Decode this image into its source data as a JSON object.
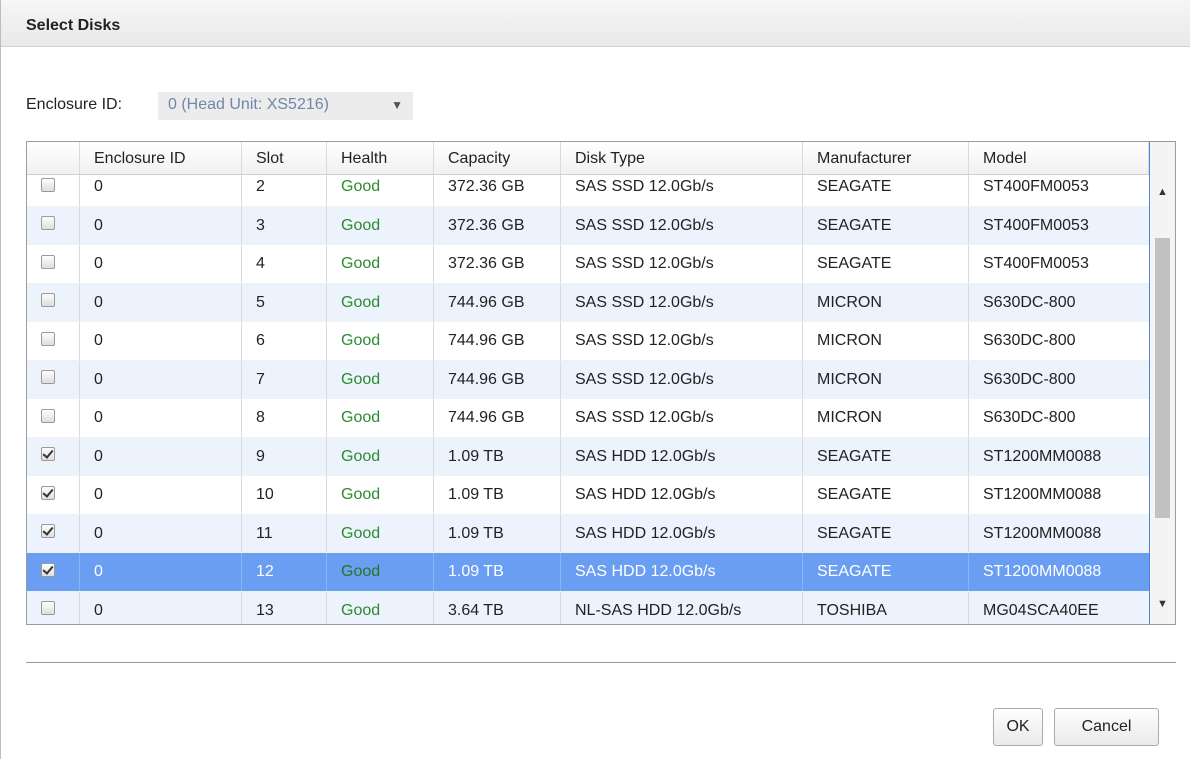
{
  "dialog": {
    "title": "Select Disks"
  },
  "enclosure": {
    "label": "Enclosure ID:",
    "selected": "0 (Head Unit: XS5216)"
  },
  "table": {
    "columns": [
      "",
      "Enclosure ID",
      "Slot",
      "Health",
      "Capacity",
      "Disk Type",
      "Manufacturer",
      "Model"
    ],
    "rows": [
      {
        "checked": false,
        "selected": false,
        "enclosure_id": "0",
        "slot": "2",
        "health": "Good",
        "capacity": "372.36 GB",
        "disk_type": "SAS SSD 12.0Gb/s",
        "manufacturer": "SEAGATE",
        "model": "ST400FM0053"
      },
      {
        "checked": false,
        "selected": false,
        "enclosure_id": "0",
        "slot": "3",
        "health": "Good",
        "capacity": "372.36 GB",
        "disk_type": "SAS SSD 12.0Gb/s",
        "manufacturer": "SEAGATE",
        "model": "ST400FM0053"
      },
      {
        "checked": false,
        "selected": false,
        "enclosure_id": "0",
        "slot": "4",
        "health": "Good",
        "capacity": "372.36 GB",
        "disk_type": "SAS SSD 12.0Gb/s",
        "manufacturer": "SEAGATE",
        "model": "ST400FM0053"
      },
      {
        "checked": false,
        "selected": false,
        "enclosure_id": "0",
        "slot": "5",
        "health": "Good",
        "capacity": "744.96 GB",
        "disk_type": "SAS SSD 12.0Gb/s",
        "manufacturer": "MICRON",
        "model": "S630DC-800"
      },
      {
        "checked": false,
        "selected": false,
        "enclosure_id": "0",
        "slot": "6",
        "health": "Good",
        "capacity": "744.96 GB",
        "disk_type": "SAS SSD 12.0Gb/s",
        "manufacturer": "MICRON",
        "model": "S630DC-800"
      },
      {
        "checked": false,
        "selected": false,
        "enclosure_id": "0",
        "slot": "7",
        "health": "Good",
        "capacity": "744.96 GB",
        "disk_type": "SAS SSD 12.0Gb/s",
        "manufacturer": "MICRON",
        "model": "S630DC-800"
      },
      {
        "checked": false,
        "selected": false,
        "enclosure_id": "0",
        "slot": "8",
        "health": "Good",
        "capacity": "744.96 GB",
        "disk_type": "SAS SSD 12.0Gb/s",
        "manufacturer": "MICRON",
        "model": "S630DC-800"
      },
      {
        "checked": true,
        "selected": false,
        "enclosure_id": "0",
        "slot": "9",
        "health": "Good",
        "capacity": "1.09 TB",
        "disk_type": "SAS HDD 12.0Gb/s",
        "manufacturer": "SEAGATE",
        "model": "ST1200MM0088"
      },
      {
        "checked": true,
        "selected": false,
        "enclosure_id": "0",
        "slot": "10",
        "health": "Good",
        "capacity": "1.09 TB",
        "disk_type": "SAS HDD 12.0Gb/s",
        "manufacturer": "SEAGATE",
        "model": "ST1200MM0088"
      },
      {
        "checked": true,
        "selected": false,
        "enclosure_id": "0",
        "slot": "11",
        "health": "Good",
        "capacity": "1.09 TB",
        "disk_type": "SAS HDD 12.0Gb/s",
        "manufacturer": "SEAGATE",
        "model": "ST1200MM0088"
      },
      {
        "checked": true,
        "selected": true,
        "enclosure_id": "0",
        "slot": "12",
        "health": "Good",
        "capacity": "1.09 TB",
        "disk_type": "SAS HDD 12.0Gb/s",
        "manufacturer": "SEAGATE",
        "model": "ST1200MM0088"
      },
      {
        "checked": false,
        "selected": false,
        "enclosure_id": "0",
        "slot": "13",
        "health": "Good",
        "capacity": "3.64 TB",
        "disk_type": "NL-SAS HDD 12.0Gb/s",
        "manufacturer": "TOSHIBA",
        "model": "MG04SCA40EE"
      }
    ]
  },
  "buttons": {
    "ok": "OK",
    "cancel": "Cancel"
  },
  "colors": {
    "selected_row": "#6a9ef2",
    "health_good": "#2e8b2e",
    "alt_row": "#ecf3fd"
  }
}
